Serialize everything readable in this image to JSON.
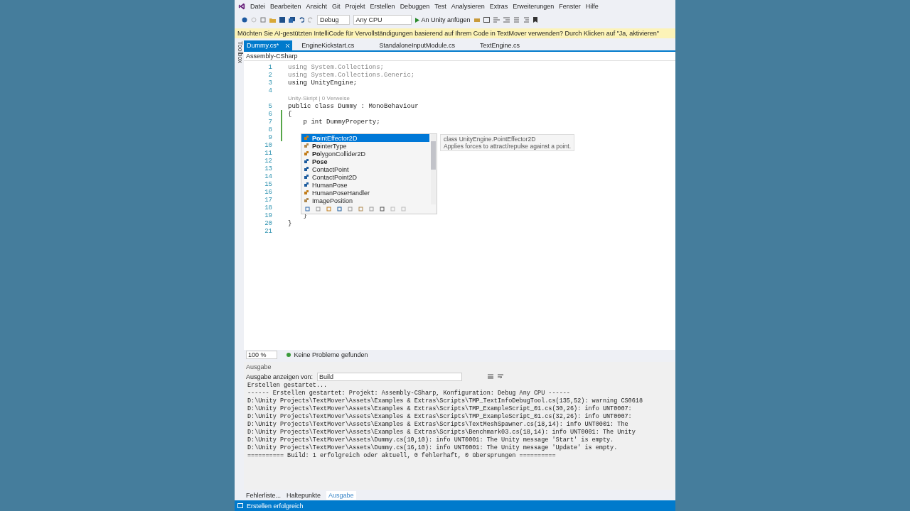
{
  "menu": [
    "Datei",
    "Bearbeiten",
    "Ansicht",
    "Git",
    "Projekt",
    "Erstellen",
    "Debuggen",
    "Test",
    "Analysieren",
    "Extras",
    "Erweiterungen",
    "Fenster",
    "Hilfe"
  ],
  "toolbar": {
    "configuration": "Debug",
    "platform": "Any CPU",
    "run_label": "An Unity anfügen"
  },
  "infobar": "Möchten Sie AI-gestützten IntelliCode für Vervollständigungen basierend auf Ihrem Code in TextMover verwenden?  Durch Klicken auf \"Ja, aktivieren\"",
  "toolbox_label": "Toolbox",
  "tabs": [
    {
      "label": "Dummy.cs*",
      "selected": true
    },
    {
      "label": "EngineKickstart.cs",
      "selected": false
    },
    {
      "label": "StandaloneInputModule.cs",
      "selected": false
    },
    {
      "label": "TextEngine.cs",
      "selected": false
    }
  ],
  "nav": "Assembly-CSharp",
  "code": [
    {
      "n": "1",
      "text": "using System.Collections;",
      "kind": "dim"
    },
    {
      "n": "2",
      "text": "using System.Collections.Generic;",
      "kind": "dim"
    },
    {
      "n": "3",
      "text": "using UnityEngine;",
      "kind": "code"
    },
    {
      "n": "4",
      "kind": "code"
    },
    {
      "text": "Unity-Skript | 0 Verweise",
      "kind": "lens"
    },
    {
      "n": "5",
      "text": "public class Dummy : MonoBehaviour",
      "kind": "code"
    },
    {
      "n": "6",
      "text": "{",
      "kind": "code"
    },
    {
      "n": "7",
      "text": "    p int DummyProperty;",
      "kind": "code"
    },
    {
      "n": "8",
      "kind": "code"
    },
    {
      "n": "9",
      "kind": "code"
    },
    {
      "n": "10",
      "kind": "code"
    },
    {
      "n": "11",
      "kind": "code"
    },
    {
      "n": "12",
      "kind": "code"
    },
    {
      "n": "13",
      "kind": "code"
    },
    {
      "n": "14",
      "kind": "code"
    },
    {
      "n": "15",
      "kind": "code"
    },
    {
      "n": "16",
      "kind": "code"
    },
    {
      "n": "17",
      "kind": "code"
    },
    {
      "n": "18",
      "kind": "code"
    },
    {
      "n": "19",
      "text": "    }",
      "kind": "code"
    },
    {
      "n": "20",
      "text": "}",
      "kind": "code"
    },
    {
      "n": "21",
      "kind": "code"
    }
  ],
  "completion": {
    "items": [
      {
        "label": "**Po**intEffector2D",
        "kind": "class",
        "selected": true
      },
      {
        "label": "**Po**interType",
        "kind": "enum",
        "selected": false
      },
      {
        "label": "**Po**lygonCollider2D",
        "kind": "class",
        "selected": false
      },
      {
        "label": "**Pose**",
        "kind": "struct",
        "selected": false
      },
      {
        "label": "ContactPoint",
        "kind": "struct",
        "selected": false
      },
      {
        "label": "ContactPoint2D",
        "kind": "struct",
        "selected": false
      },
      {
        "label": "HumanPose",
        "kind": "struct",
        "selected": false
      },
      {
        "label": "HumanPoseHandler",
        "kind": "class",
        "selected": false
      },
      {
        "label": "ImagePosition",
        "kind": "enum",
        "selected": false
      }
    ],
    "tooltip_signature": "class UnityEngine.PointEffector2D",
    "tooltip_description": "Applies forces to attract/repulse against a point."
  },
  "editor_status": {
    "zoom": "100 %",
    "problems": "Keine Probleme gefunden"
  },
  "output": {
    "title": "Ausgabe",
    "source_label": "Ausgabe anzeigen von:",
    "source": "Build",
    "lines": [
      "Erstellen gestartet...",
      "------ Erstellen gestartet: Projekt: Assembly-CSharp, Konfiguration: Debug Any CPU ------",
      "D:\\Unity Projects\\TextMover\\Assets\\Examples & Extras\\Scripts\\TMP_TextInfoDebugTool.cs(135,52): warning CS0618",
      "D:\\Unity Projects\\TextMover\\Assets\\Examples & Extras\\Scripts\\TMP_ExampleScript_01.cs(30,26): info UNT0007:",
      "D:\\Unity Projects\\TextMover\\Assets\\Examples & Extras\\Scripts\\TMP_ExampleScript_01.cs(32,26): info UNT0007:",
      "D:\\Unity Projects\\TextMover\\Assets\\Examples & Extras\\Scripts\\TextMeshSpawner.cs(18,14): info UNT0001: The",
      "D:\\Unity Projects\\TextMover\\Assets\\Examples & Extras\\Scripts\\Benchmark03.cs(18,14): info UNT0001: The Unity",
      "D:\\Unity Projects\\TextMover\\Assets\\Dummy.cs(10,10): info UNT0001: The Unity message 'Start' is empty.",
      "D:\\Unity Projects\\TextMover\\Assets\\Dummy.cs(16,10): info UNT0001: The Unity message 'Update' is empty.",
      "========== Build: 1 erfolgreich oder aktuell, 0 fehlerhaft, 0 übersprungen =========="
    ]
  },
  "bottom_tabs": [
    {
      "label": "Fehlerliste...",
      "selected": false
    },
    {
      "label": "Haltepunkte",
      "selected": false
    },
    {
      "label": "Ausgabe",
      "selected": true
    }
  ],
  "status_bar": "Erstellen erfolgreich"
}
